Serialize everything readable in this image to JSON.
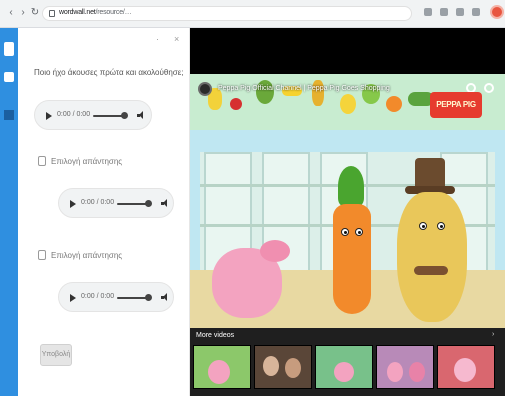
{
  "browser": {
    "url_host": "wordwall.net",
    "url_path": "/resource/…",
    "colors": {
      "chrome_bg": "#f1f3f4",
      "profile": "#e8553f"
    }
  },
  "sidebar": {
    "accent": "#2f8fe0"
  },
  "panel": {
    "title": "Ποιο ήχο άκουσες πρώτα και ακολούθησε;",
    "close_glyph": "×",
    "pin_glyph": "·",
    "audio_players": [
      {
        "time": "0:00 / 0:00"
      },
      {
        "time": "0:00 / 0:00"
      },
      {
        "time": "0:00 / 0:00"
      }
    ],
    "options": [
      {
        "label": "Επιλογή απάντησης"
      },
      {
        "label": "Επιλογή απάντησης"
      }
    ],
    "submit_label": "Υποβολή"
  },
  "video": {
    "title": "Peppa Pig Official Channel | Peppa Pig Goes Shopping",
    "logo": "PEPPA PIG",
    "more_videos_label": "More videos",
    "more_close_glyph": "›",
    "thumbnails": [
      {
        "name": "thumb-1",
        "bg": "#8cc86a"
      },
      {
        "name": "thumb-2",
        "bg": "#5a4638"
      },
      {
        "name": "thumb-3",
        "bg": "#78c18a"
      },
      {
        "name": "thumb-4",
        "bg": "#b88ab8"
      },
      {
        "name": "thumb-5",
        "bg": "#d9676f"
      }
    ]
  }
}
